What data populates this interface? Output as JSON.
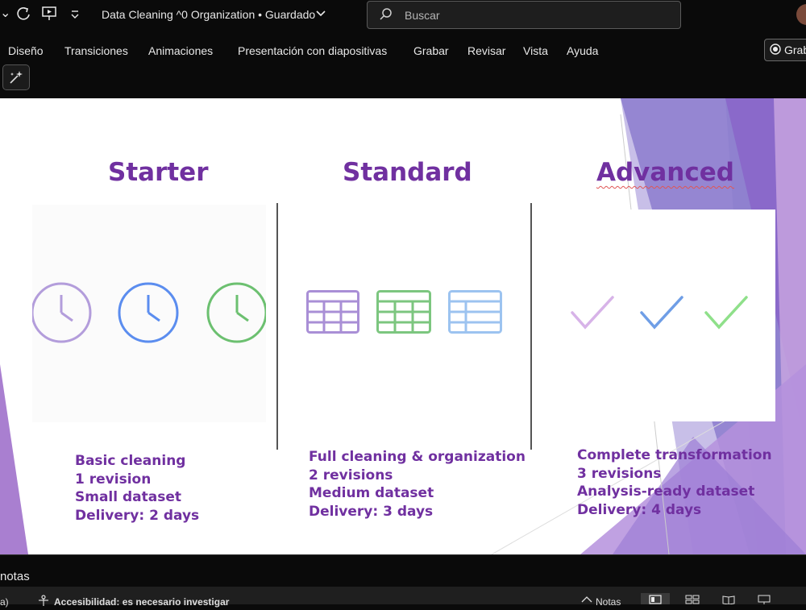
{
  "titlebar": {
    "doc_title": "Data Cleaning ^0 Organization • Guardado",
    "search_placeholder": "Buscar"
  },
  "ribbon": {
    "tabs": [
      "Diseño",
      "Transiciones",
      "Animaciones",
      "Presentación con diapositivas",
      "Grabar",
      "Revisar",
      "Vista",
      "Ayuda"
    ],
    "record_label": "Grab"
  },
  "slide": {
    "plans": [
      {
        "title": "Starter",
        "icon_type": "clock-icon",
        "lines": [
          "Basic cleaning",
          "1 revision",
          "Small dataset",
          "Delivery: 2 days"
        ]
      },
      {
        "title": "Standard",
        "icon_type": "table-icon",
        "lines": [
          "Full cleaning & organization",
          "2 revisions",
          "Medium dataset",
          "Delivery: 3 days"
        ]
      },
      {
        "title": "Advanced",
        "icon_type": "checkmark-icon",
        "lines": [
          "Complete transformation",
          "3 revisions",
          "Analysis-ready dataset",
          "Delivery: 4 days"
        ]
      }
    ],
    "colors": {
      "title": "#7030a0",
      "purple_light": "#b39ddb",
      "blue": "#5b8def",
      "green": "#6cc070"
    }
  },
  "bottom": {
    "notes_label": "notas",
    "accessibility": "Accesibilidad: es necesario investigar",
    "notes_button": "Notas",
    "status_left": "a)"
  }
}
